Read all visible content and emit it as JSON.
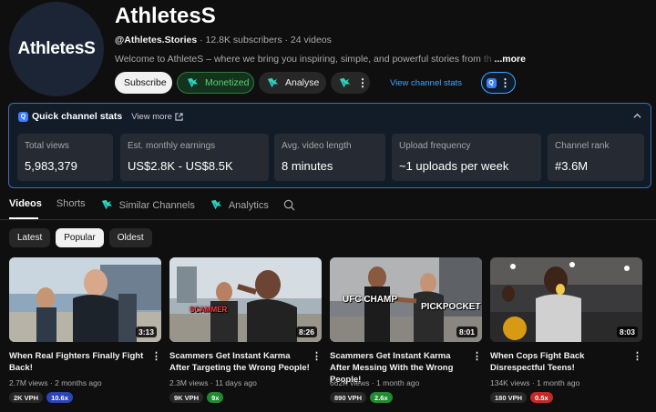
{
  "channel": {
    "avatar_text": "AthletesS",
    "name": "AthletesS",
    "handle": "@Athletes.Stories",
    "subscribers": "12.8K subscribers",
    "videos_count": "24 videos",
    "separator": "·",
    "description": "Welcome to AthleteS – where we bring you inspiring, simple, and powerful stories from",
    "description_fade": "th",
    "more_label": "...more"
  },
  "buttons": {
    "subscribe": "Subscribe",
    "monetized": "Monetized",
    "analyse": "Analyse",
    "view_channel_stats": "View channel stats",
    "quick_badge": "Q"
  },
  "quick_stats": {
    "title": "Quick channel stats",
    "view_more": "View more",
    "stats": [
      {
        "label": "Total views",
        "value": "5,983,379"
      },
      {
        "label": "Est. monthly earnings",
        "value": "US$2.8K - US$8.5K"
      },
      {
        "label": "Avg. video length",
        "value": "8 minutes"
      },
      {
        "label": "Upload frequency",
        "value": "~1 uploads per week"
      },
      {
        "label": "Channel rank",
        "value": "#3.6M"
      }
    ]
  },
  "tabs": [
    "Videos",
    "Shorts",
    "Similar Channels",
    "Analytics"
  ],
  "filters": [
    "Latest",
    "Popular",
    "Oldest"
  ],
  "filters_selected": "Popular",
  "videos": [
    {
      "title": "When Real Fighters Finally Fight Back!",
      "views": "2.7M views",
      "age": "2 months ago",
      "duration": "3:13",
      "vph": "2K VPH",
      "multiplier": "10.6x",
      "multiplier_color": "#2b45b8",
      "overlay": ""
    },
    {
      "title": "Scammers Get Instant Karma After Targeting the Wrong People!",
      "views": "2.3M views",
      "age": "11 days ago",
      "duration": "8:26",
      "vph": "9K VPH",
      "multiplier": "9x",
      "multiplier_color": "#1f8a2e",
      "overlay": "SCAMMER"
    },
    {
      "title": "Scammers Get Instant Karma After Messing With the Wrong People!",
      "views": "662K views",
      "age": "1 month ago",
      "duration": "8:01",
      "vph": "890 VPH",
      "multiplier": "2.6x",
      "multiplier_color": "#1f8a2e",
      "overlay": "UFC CHAMP",
      "overlay2": "PICKPOCKET"
    },
    {
      "title": "When Cops Fight Back Disrespectful Teens!",
      "views": "134K views",
      "age": "1 month ago",
      "duration": "8:03",
      "vph": "180 VPH",
      "multiplier": "0.5x",
      "multiplier_color": "#c62828",
      "overlay": ""
    }
  ]
}
